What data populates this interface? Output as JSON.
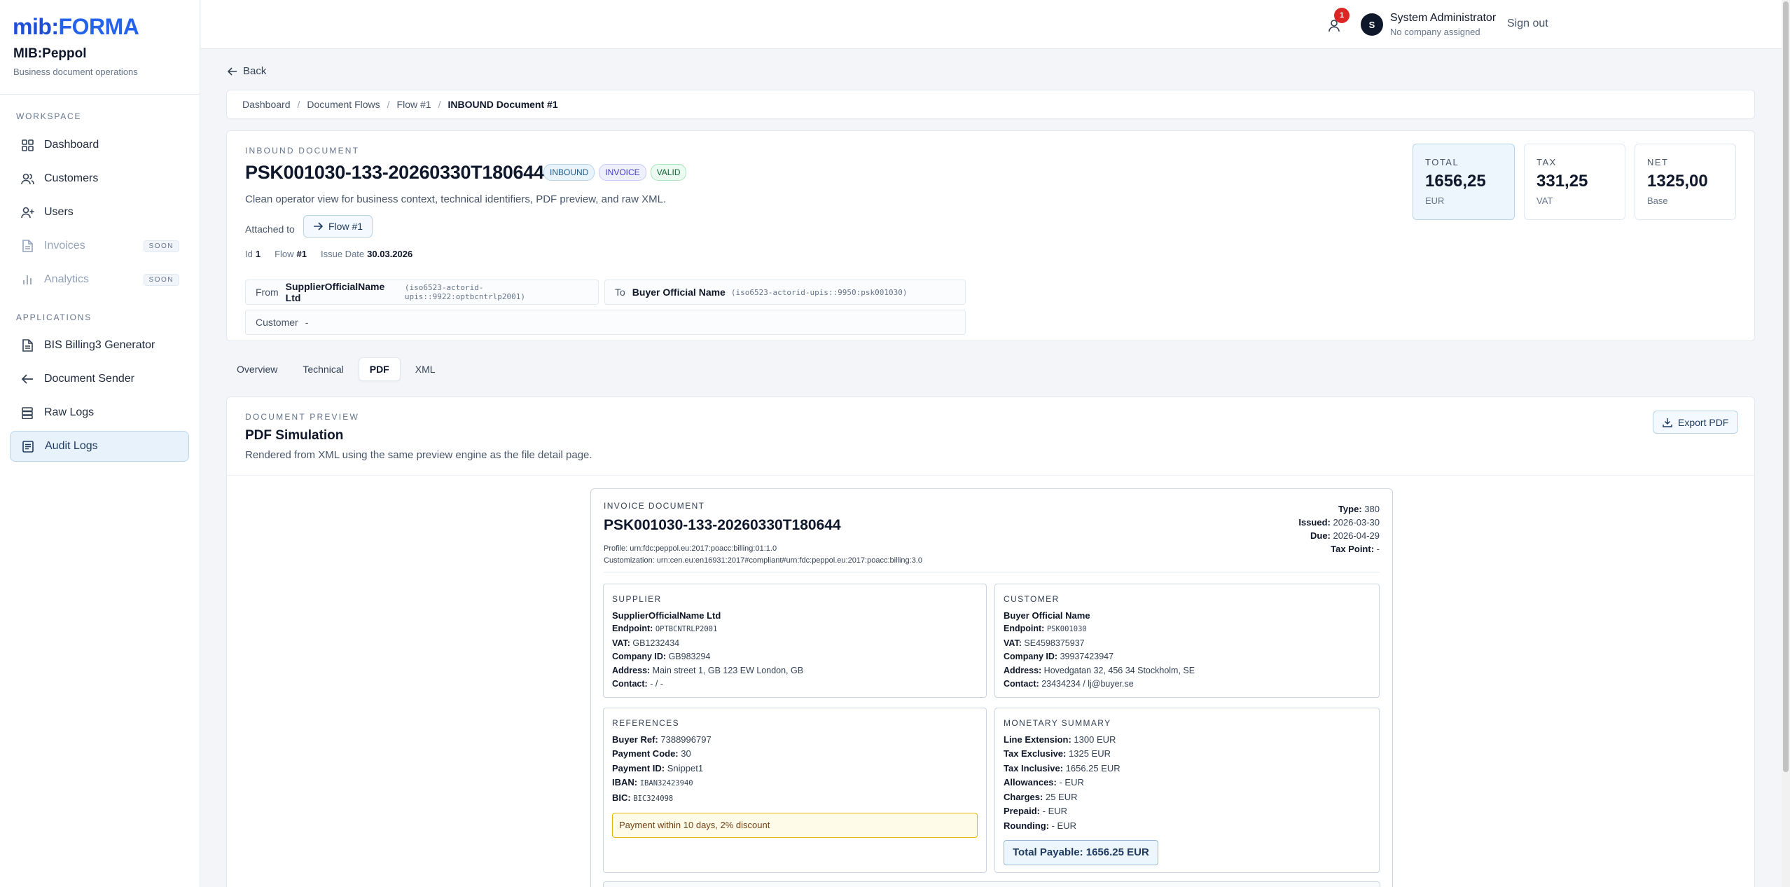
{
  "brand": {
    "logo_part1": "mib:",
    "logo_part2": "FORMA",
    "app_name": "MIB:Peppol",
    "app_subtitle": "Business document operations"
  },
  "sidebar": {
    "workspace_title": "WORKSPACE",
    "workspace_items": [
      {
        "label": "Dashboard",
        "icon": "grid-icon"
      },
      {
        "label": "Customers",
        "icon": "users-icon"
      },
      {
        "label": "Users",
        "icon": "user-plus-icon"
      },
      {
        "label": "Invoices",
        "icon": "document-icon",
        "badge": "SOON"
      },
      {
        "label": "Analytics",
        "icon": "bar-chart-icon",
        "badge": "SOON"
      }
    ],
    "applications_title": "APPLICATIONS",
    "application_items": [
      {
        "label": "BIS Billing3 Generator",
        "icon": "document-icon"
      },
      {
        "label": "Document Sender",
        "icon": "arrow-left-icon"
      },
      {
        "label": "Raw Logs",
        "icon": "database-icon"
      },
      {
        "label": "Audit Logs",
        "icon": "list-doc-icon",
        "active": true
      }
    ]
  },
  "topbar": {
    "notification_count": "1",
    "avatar_initial": "S",
    "user_name": "System Administrator",
    "user_sub": "No company assigned",
    "signout": "Sign out"
  },
  "nav": {
    "back": "Back"
  },
  "breadcrumb": [
    "Dashboard",
    "Document Flows",
    "Flow #1",
    "INBOUND Document #1"
  ],
  "document": {
    "eyebrow": "INBOUND DOCUMENT",
    "title": "PSK001030-133-20260330T180644",
    "badges": [
      "INBOUND",
      "INVOICE",
      "VALID"
    ],
    "description": "Clean operator view for business context, technical identifiers, PDF preview, and raw XML.",
    "attached_label": "Attached to",
    "flow_button": "Flow #1",
    "meta": {
      "id_label": "Id",
      "id": "1",
      "flow_label": "Flow",
      "flow": "#1",
      "issue_label": "Issue Date",
      "issue": "30.03.2026"
    },
    "from": {
      "label": "From",
      "name": "SupplierOfficialName Ltd",
      "id": "(iso6523-actorid-upis::9922:optbcntrlp2001)"
    },
    "to": {
      "label": "To",
      "name": "Buyer Official Name",
      "id": "(iso6523-actorid-upis::9950:psk001030)"
    },
    "customer": {
      "label": "Customer",
      "value": "-"
    },
    "kpis": [
      {
        "label": "TOTAL",
        "value": "1656,25",
        "unit": "EUR"
      },
      {
        "label": "TAX",
        "value": "331,25",
        "unit": "VAT"
      },
      {
        "label": "NET",
        "value": "1325,00",
        "unit": "Base"
      }
    ]
  },
  "tabs": [
    "Overview",
    "Technical",
    "PDF",
    "XML"
  ],
  "preview": {
    "eyebrow": "DOCUMENT PREVIEW",
    "title": "PDF Simulation",
    "description": "Rendered from XML using the same preview engine as the file detail page.",
    "export": "Export PDF"
  },
  "invoice": {
    "eyebrow": "INVOICE DOCUMENT",
    "title": "PSK001030-133-20260330T180644",
    "profile": "Profile: urn:fdc:peppol.eu:2017:poacc:billing:01:1.0",
    "customization": "Customization: urn:cen.eu:en16931:2017#compliant#urn:fdc:peppol.eu:2017:poacc:billing:3.0",
    "type_label": "Type:",
    "type": "380",
    "issued_label": "Issued:",
    "issued": "2026-03-30",
    "due_label": "Due:",
    "due": "2026-04-29",
    "taxpoint_label": "Tax Point:",
    "taxpoint": "-",
    "supplier": {
      "heading": "SUPPLIER",
      "name": "SupplierOfficialName Ltd",
      "endpoint_label": "Endpoint:",
      "endpoint": "OPTBCNTRLP2001",
      "vat_label": "VAT:",
      "vat": "GB1232434",
      "company_label": "Company ID:",
      "company": "GB983294",
      "address_label": "Address:",
      "address": "Main street 1, GB 123 EW London, GB",
      "contact_label": "Contact:",
      "contact": "- / -"
    },
    "customer": {
      "heading": "CUSTOMER",
      "name": "Buyer Official Name",
      "endpoint_label": "Endpoint:",
      "endpoint": "PSK001030",
      "vat_label": "VAT:",
      "vat": "SE4598375937",
      "company_label": "Company ID:",
      "company": "39937423947",
      "address_label": "Address:",
      "address": "Hovedgatan 32, 456 34 Stockholm, SE",
      "contact_label": "Contact:",
      "contact": "23434234 / lj@buyer.se"
    },
    "references": {
      "heading": "REFERENCES",
      "buyer_ref_label": "Buyer Ref:",
      "buyer_ref": "7388996797",
      "payment_code_label": "Payment Code:",
      "payment_code": "30",
      "payment_id_label": "Payment ID:",
      "payment_id": "Snippet1",
      "iban_label": "IBAN:",
      "iban": "IBAN32423940",
      "bic_label": "BIC:",
      "bic": "BIC324098",
      "note": "Payment within 10 days, 2% discount"
    },
    "monetary": {
      "heading": "MONETARY SUMMARY",
      "line_ext_label": "Line Extension:",
      "line_ext": "1300 EUR",
      "tax_excl_label": "Tax Exclusive:",
      "tax_excl": "1325 EUR",
      "tax_incl_label": "Tax Inclusive:",
      "tax_incl": "1656.25 EUR",
      "allow_label": "Allowances:",
      "allow": "- EUR",
      "charges_label": "Charges:",
      "charges": "25 EUR",
      "prepaid_label": "Prepaid:",
      "prepaid": "- EUR",
      "rounding_label": "Rounding:",
      "rounding": "- EUR",
      "total_payable": "Total Payable: 1656.25 EUR"
    }
  }
}
